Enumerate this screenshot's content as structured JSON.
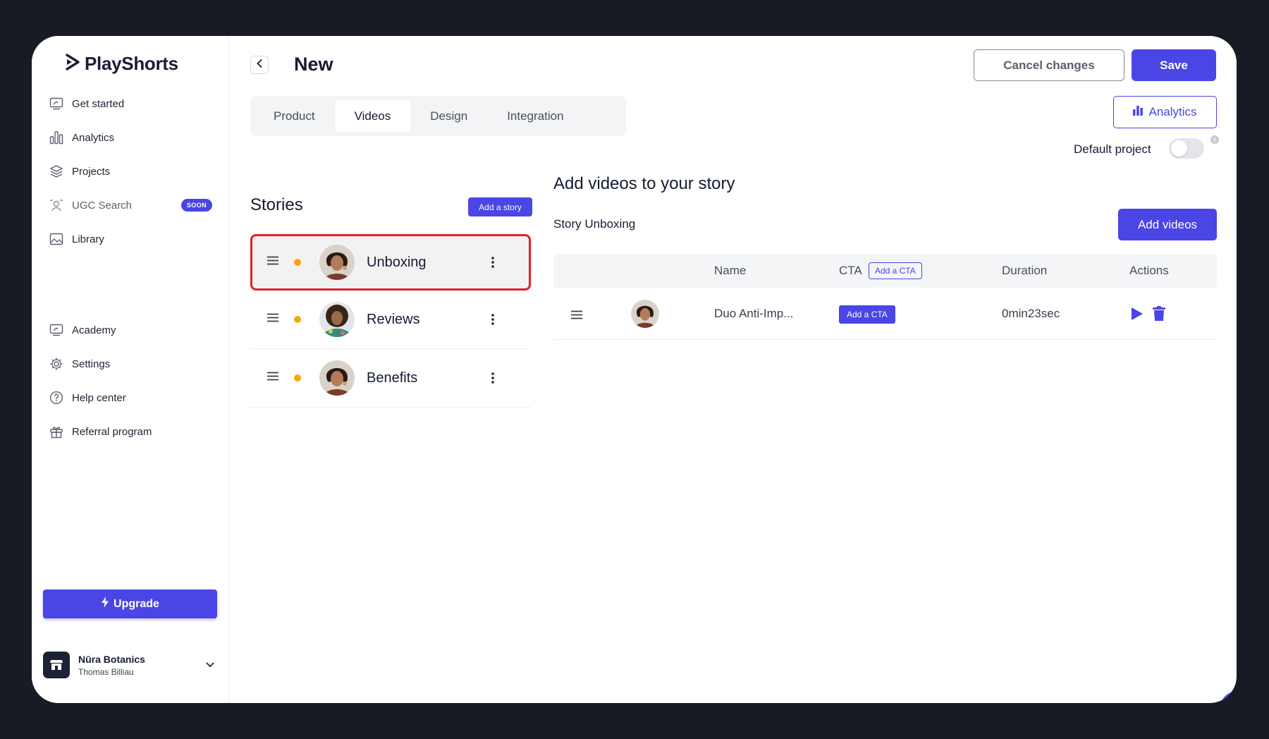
{
  "brand": {
    "name": "PlayShorts",
    "accent": "#4a45e5"
  },
  "sidebar": {
    "items": [
      {
        "label": "Get started",
        "icon": "rocket-screen-icon"
      },
      {
        "label": "Analytics",
        "icon": "bar-chart-icon"
      },
      {
        "label": "Projects",
        "icon": "layers-icon"
      },
      {
        "label": "UGC Search",
        "icon": "person-search-icon",
        "badge": "SOON"
      },
      {
        "label": "Library",
        "icon": "image-icon"
      }
    ],
    "items2": [
      {
        "label": "Academy",
        "icon": "academy-icon"
      },
      {
        "label": "Settings",
        "icon": "gear-icon"
      },
      {
        "label": "Help center",
        "icon": "help-circle-icon"
      },
      {
        "label": "Referral program",
        "icon": "gift-icon"
      }
    ],
    "upgrade_label": "Upgrade",
    "account": {
      "name": "Nūra Botanics",
      "user": "Thomas Billiau"
    }
  },
  "header": {
    "title": "New",
    "cancel_label": "Cancel changes",
    "save_label": "Save"
  },
  "tabs": [
    {
      "label": "Product",
      "active": false
    },
    {
      "label": "Videos",
      "active": true
    },
    {
      "label": "Design",
      "active": false
    },
    {
      "label": "Integration",
      "active": false
    }
  ],
  "analytics_label": "Analytics",
  "default_project": {
    "label": "Default project",
    "enabled": false
  },
  "stories": {
    "title": "Stories",
    "add_label": "Add a story",
    "items": [
      {
        "name": "Unboxing",
        "selected": true,
        "status_color": "#f6a60a"
      },
      {
        "name": "Reviews",
        "selected": false,
        "status_color": "#f6a60a"
      },
      {
        "name": "Benefits",
        "selected": false,
        "status_color": "#f6a60a"
      }
    ]
  },
  "videos": {
    "title": "Add videos to your story",
    "story_label": "Story Unboxing",
    "add_label": "Add videos",
    "columns": {
      "name": "Name",
      "cta": "CTA",
      "cta_button": "Add a CTA",
      "duration": "Duration",
      "actions": "Actions"
    },
    "rows": [
      {
        "name": "Duo Anti-Imp...",
        "cta_button": "Add a CTA",
        "duration": "0min23sec"
      }
    ]
  }
}
